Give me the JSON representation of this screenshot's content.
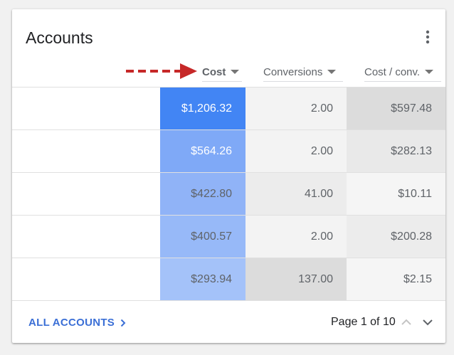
{
  "card": {
    "title": "Accounts",
    "menu_icon": "more-vert-icon"
  },
  "columns": [
    {
      "label": "Cost",
      "sorted": true
    },
    {
      "label": "Conversions",
      "sorted": false
    },
    {
      "label": "Cost / conv.",
      "sorted": false
    }
  ],
  "rows": [
    {
      "account": "",
      "cost": "$1,206.32",
      "conversions": "2.00",
      "cost_per_conv": "$597.48"
    },
    {
      "account": "",
      "cost": "$564.26",
      "conversions": "2.00",
      "cost_per_conv": "$282.13"
    },
    {
      "account": "",
      "cost": "$422.80",
      "conversions": "41.00",
      "cost_per_conv": "$10.11"
    },
    {
      "account": "",
      "cost": "$400.57",
      "conversions": "2.00",
      "cost_per_conv": "$200.28"
    },
    {
      "account": "",
      "cost": "$293.94",
      "conversions": "137.00",
      "cost_per_conv": "$2.15"
    }
  ],
  "heat": {
    "cost": [
      "#4285f4",
      "#7fa9f7",
      "#90b3f7",
      "#97b9f8",
      "#a4c2f9"
    ],
    "cost_text": [
      "#ffffff",
      "#ffffff",
      "#5f6368",
      "#5f6368",
      "#5f6368"
    ],
    "conversions": [
      "#f3f3f3",
      "#f3f3f3",
      "#ececec",
      "#f3f3f3",
      "#dcdcdc"
    ],
    "cost_per_conv": [
      "#dcdcdc",
      "#e9e9e9",
      "#f5f5f5",
      "#ececec",
      "#f5f5f5"
    ]
  },
  "annotation": {
    "arrow_color": "#c62828",
    "arrow_icon": "dashed-arrow-right-icon"
  },
  "footer": {
    "all_accounts_label": "ALL ACCOUNTS",
    "page_info": "Page 1 of 10",
    "prev_icon": "chevron-up-icon",
    "next_icon": "chevron-down-icon"
  }
}
